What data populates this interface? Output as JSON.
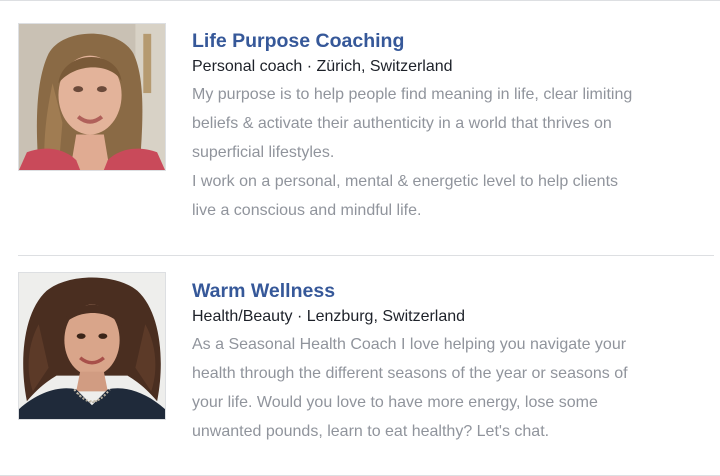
{
  "listings": [
    {
      "name": "Life Purpose Coaching",
      "meta": "Personal coach · Zürich, Switzerland",
      "description": [
        "My purpose is to help people find meaning in life, clear limiting",
        "beliefs & activate their authenticity in a world that thrives on",
        "superficial lifestyles.",
        "I work on a personal, mental & energetic level to help clients",
        "live a conscious and mindful life."
      ]
    },
    {
      "name": "Warm Wellness",
      "meta": "Health/Beauty · Lenzburg, Switzerland",
      "description": [
        "As a Seasonal Health Coach I love helping you navigate your",
        "health through the different seasons of the year or seasons of",
        "your life. Would you love to have more energy, lose some",
        "unwanted pounds, learn to eat healthy? Let's chat."
      ]
    }
  ],
  "colors": {
    "link": "#365899",
    "meta": "#1d2129",
    "description": "#90949c",
    "divider": "#dddfe2"
  }
}
